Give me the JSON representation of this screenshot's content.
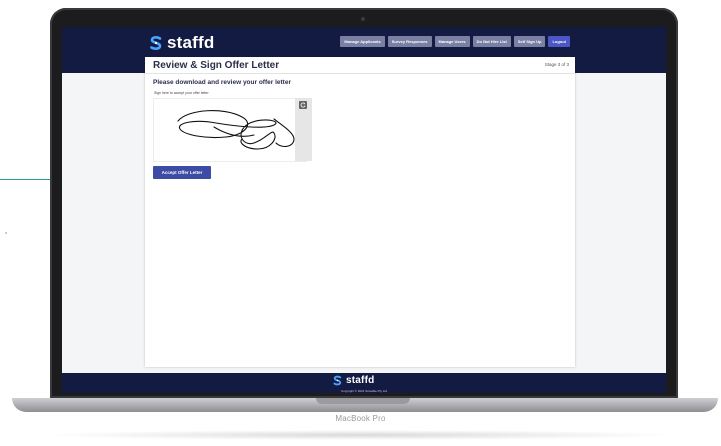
{
  "device": {
    "label": "MacBook Pro"
  },
  "header": {
    "brand": "staffd",
    "nav": [
      {
        "label": "Manage Applicants"
      },
      {
        "label": "Survey Responses"
      },
      {
        "label": "Manage Users"
      },
      {
        "label": "Do Not Hire List"
      },
      {
        "label": "Self Sign Up"
      },
      {
        "label": "Logout"
      }
    ]
  },
  "card": {
    "title": "Review & Sign Offer Letter",
    "stage": "Stage 3 of 3",
    "subheading": "Please download and review your offer letter",
    "signature_label": "Sign here to accept your offer letter",
    "accept_button": "Accept Offer Letter"
  },
  "footer": {
    "brand": "staffd",
    "copyright": "Copyright © 2021 Solvable Pty Ltd"
  },
  "colors": {
    "header_bg": "#141b43",
    "accent": "#3c4ba3",
    "callout": "#2a9d8f"
  },
  "icons": {
    "brand_mark": "staffd-s-logo",
    "reset": "refresh-icon"
  }
}
